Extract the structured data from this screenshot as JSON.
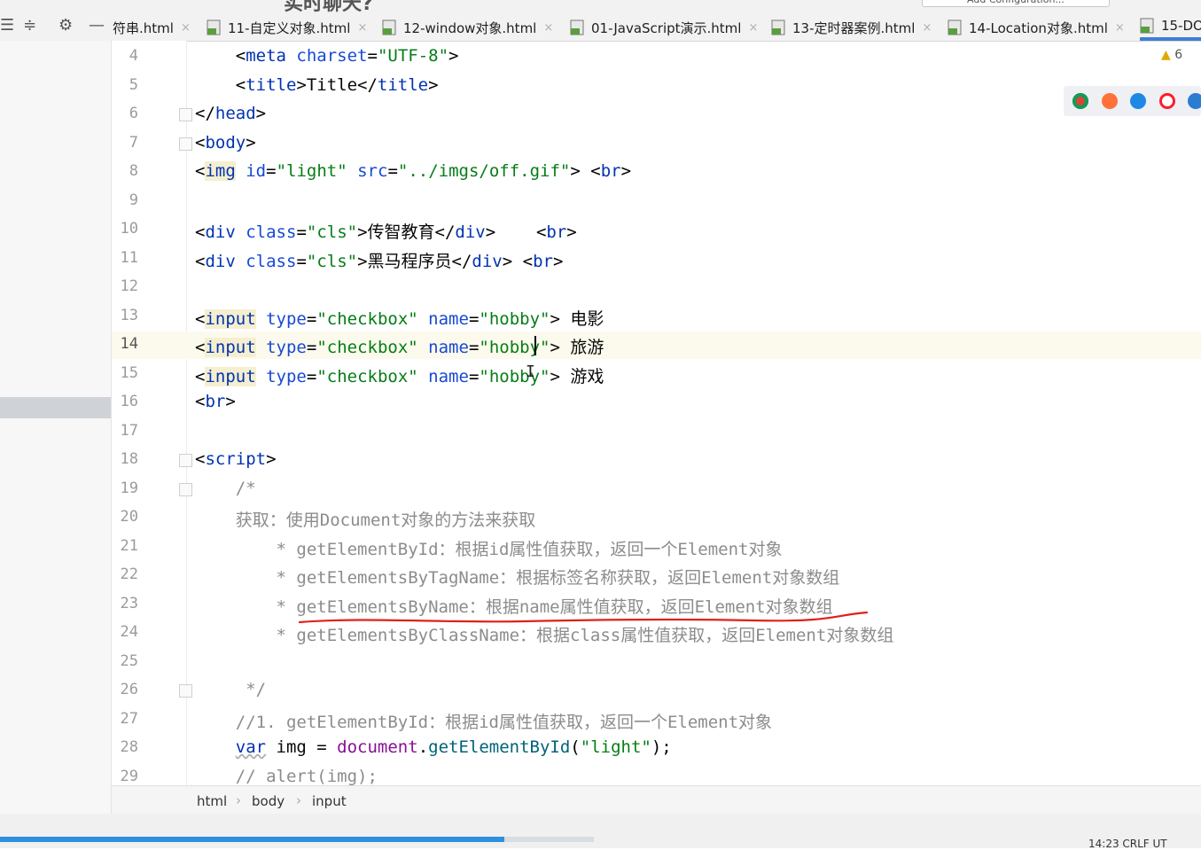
{
  "tabs": [
    {
      "label": "符串.html",
      "active": false
    },
    {
      "label": "11-自定义对象.html",
      "active": false
    },
    {
      "label": "12-window对象.html",
      "active": false
    },
    {
      "label": "01-JavaScript演示.html",
      "active": false
    },
    {
      "label": "13-定时器案例.html",
      "active": false
    },
    {
      "label": "14-Location对象.html",
      "active": false
    },
    {
      "label": "15-DO",
      "active": true
    }
  ],
  "close_glyph": "×",
  "inspections": {
    "warning_count": "6",
    "warning_icon": "warning-triangle-icon"
  },
  "browsers": [
    "chrome-icon",
    "firefox-icon",
    "safari-icon",
    "opera-icon",
    "edge-icon"
  ],
  "browser_colors": {
    "chrome": "#db4437",
    "firefox": "#ff7139",
    "safari": "#1e88e5",
    "opera": "#ff1b2d",
    "edge": "#2b7cd3"
  },
  "editor": {
    "line_numbers": [
      "4",
      "5",
      "6",
      "7",
      "8",
      "9",
      "10",
      "11",
      "12",
      "13",
      "14",
      "15",
      "16",
      "17",
      "18",
      "19",
      "20",
      "21",
      "22",
      "23",
      "24",
      "25",
      "26",
      "27",
      "28",
      "29"
    ],
    "current_line": "14",
    "lines": {
      "l4": [
        "    <",
        "meta",
        " ",
        "charset",
        "=",
        "\"UTF-8\"",
        ">"
      ],
      "l5": [
        "    <",
        "title",
        ">Title</",
        "title",
        ">"
      ],
      "l6": [
        "</",
        "head",
        ">"
      ],
      "l7": [
        "<",
        "body",
        ">"
      ],
      "l8": [
        "<",
        "img",
        " ",
        "id",
        "=",
        "\"light\"",
        " ",
        "src",
        "=",
        "\"../imgs/off.gif\"",
        "> <",
        "br",
        ">"
      ],
      "l10": [
        "<",
        "div",
        " ",
        "class",
        "=",
        "\"cls\"",
        ">传智教育</",
        "div",
        ">    <",
        "br",
        ">"
      ],
      "l11": [
        "<",
        "div",
        " ",
        "class",
        "=",
        "\"cls\"",
        ">黑马程序员</",
        "div",
        "> <",
        "br",
        ">"
      ],
      "l13": [
        "<",
        "input",
        " ",
        "type",
        "=",
        "\"checkbox\"",
        " ",
        "name",
        "=",
        "\"hobby\"",
        "> 电影"
      ],
      "l14": [
        "<",
        "input",
        " ",
        "type",
        "=",
        "\"checkbox\"",
        " ",
        "name",
        "=",
        "\"hobby\"",
        "> 旅游"
      ],
      "l15": [
        "<",
        "input",
        " ",
        "type",
        "=",
        "\"checkbox\"",
        " ",
        "name",
        "=",
        "\"hobby\"",
        "> 游戏"
      ],
      "l16": [
        "<",
        "br",
        ">"
      ],
      "l18": [
        "<",
        "script",
        ">"
      ],
      "l19": "    /*",
      "l20": "    获取：使用Document对象的方法来获取",
      "l21": "        * getElementById：根据id属性值获取，返回一个Element对象",
      "l22": "        * getElementsByTagName：根据标签名称获取，返回Element对象数组",
      "l23": "        * getElementsByName：根据name属性值获取，返回Element对象数组",
      "l24": "        * getElementsByClassName：根据class属性值获取，返回Element对象数组",
      "l26": "     */",
      "l27": "    //1. getElementById：根据id属性值获取，返回一个Element对象",
      "l28": [
        "    ",
        "var",
        " img = ",
        "document",
        ".",
        "getElementById",
        "(",
        "\"light\"",
        ");"
      ],
      "l29": "    // alert(img);"
    }
  },
  "breadcrumb": [
    "html",
    "body",
    "input"
  ],
  "breadcrumb_sep": "›",
  "status": {
    "progress": 0.42,
    "right_text": "14:23   CRLF   UT"
  },
  "annotation_color": "#e0201a",
  "top_remnant": "实时聊天?",
  "config_remnant": "Add Configuration..."
}
